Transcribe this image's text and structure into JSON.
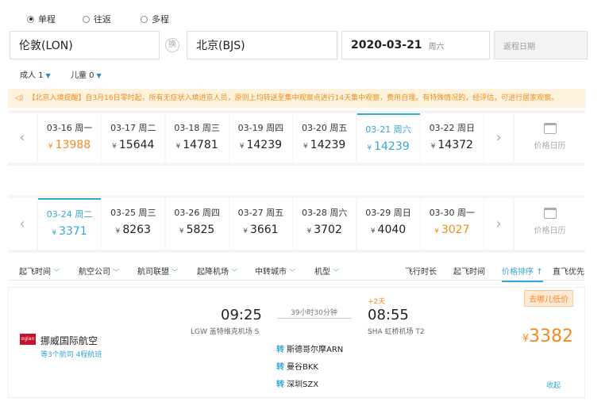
{
  "trip_type": {
    "options": [
      "单程",
      "往返",
      "多程"
    ],
    "selected": 0
  },
  "search": {
    "from": "伦敦(LON)",
    "to": "北京(BJS)",
    "swap_label": "换",
    "date": "2020-03-21",
    "weekday": "周六",
    "return_placeholder": "返程日期"
  },
  "passengers": {
    "adult": "成人 1",
    "child": "儿童 0"
  },
  "notice": "【北京入境提醒】自3月16日零时起，所有无症状入境进京人员，原则上均转送至集中观察点进行14天集中观察，费用自理。有特殊情况的，经评估，可进行居家观察。",
  "date_strip_1": [
    {
      "date": "03-16 周一",
      "price": "13988",
      "style": "orange"
    },
    {
      "date": "03-17 周二",
      "price": "15644"
    },
    {
      "date": "03-18 周三",
      "price": "14781"
    },
    {
      "date": "03-19 周四",
      "price": "14239"
    },
    {
      "date": "03-20 周五",
      "price": "14239"
    },
    {
      "date": "03-21 周六",
      "price": "14239",
      "style": "selected"
    },
    {
      "date": "03-22 周日",
      "price": "14372"
    }
  ],
  "date_strip_2": [
    {
      "date": "03-24 周二",
      "price": "3371",
      "style": "selected"
    },
    {
      "date": "03-25 周三",
      "price": "8263"
    },
    {
      "date": "03-26 周四",
      "price": "5825"
    },
    {
      "date": "03-27 周五",
      "price": "3661"
    },
    {
      "date": "03-28 周六",
      "price": "3702"
    },
    {
      "date": "03-29 周日",
      "price": "4040"
    },
    {
      "date": "03-30 周一",
      "price": "3027",
      "style": "orange"
    }
  ],
  "currency": "¥",
  "calendar_label": "价格日历",
  "filters": {
    "left": [
      "起飞时间",
      "航空公司",
      "航司联盟",
      "起降机场",
      "中转城市",
      "机型"
    ],
    "sort": [
      "飞行时长",
      "起飞时间",
      "价格排序",
      "直飞优先"
    ],
    "active_sort": "价格排序"
  },
  "flight": {
    "airline": "挪威国际航空",
    "airline_logo_text": "ogian",
    "airline_sub": "等3个航司 4程航班",
    "depart_time": "09:25",
    "depart_airport": "LGW 盖特维克机场 S",
    "duration": "39小时30分钟",
    "plus_days": "+2天",
    "arrive_time": "08:55",
    "arrive_airport": "SHA 虹桥机场 T2",
    "transfer_tag": "转",
    "transfers": [
      "斯德哥尔摩ARN",
      "曼谷BKK",
      "深圳SZX"
    ],
    "tag": "去哪儿低价",
    "price": "3382",
    "collapse": "收起"
  },
  "colors": {
    "accent": "#34a7d7",
    "orange": "#f08b1f",
    "notice_bg": "#fdf3dc"
  }
}
